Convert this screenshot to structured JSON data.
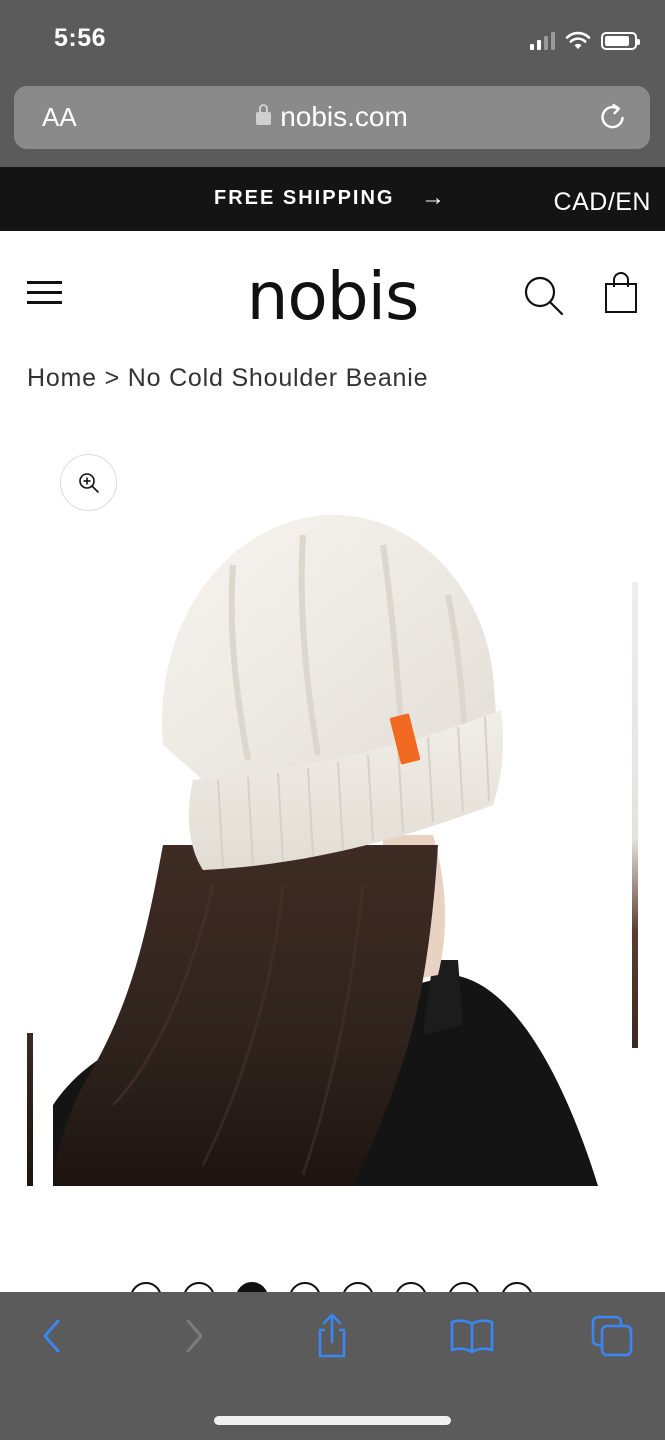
{
  "status_bar": {
    "time": "5:56"
  },
  "address_bar": {
    "text_size_label": "AA",
    "url": "nobis.com"
  },
  "promo_bar": {
    "text": "FREE SHIPPING",
    "arrow": "→",
    "locale": "CAD/EN"
  },
  "header": {
    "logo": "nobis",
    "menu_icon": "hamburger-menu-icon",
    "search_icon": "search-icon",
    "cart_icon": "shopping-bag-icon"
  },
  "breadcrumb": {
    "text": "Home > No Cold Shoulder Beanie"
  },
  "gallery": {
    "zoom_icon": "zoom-in-icon",
    "slide_count": 8,
    "active_slide": 3
  },
  "toolbar": {
    "icons": [
      "back-icon",
      "forward-icon",
      "share-icon",
      "bookmarks-icon",
      "tabs-icon"
    ],
    "accent_color": "#3a86f5"
  }
}
